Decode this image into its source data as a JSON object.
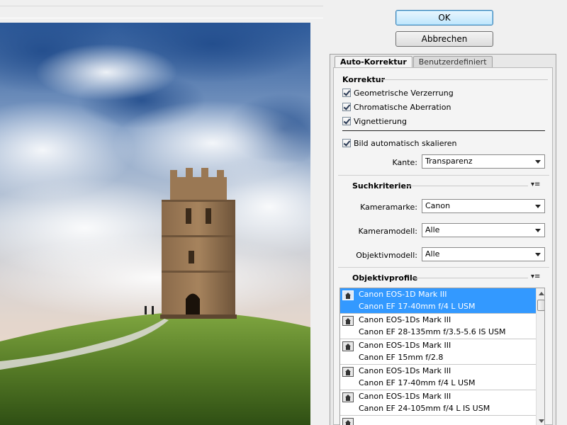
{
  "dialog": {
    "ok_label": "OK",
    "cancel_label": "Abbrechen"
  },
  "tabs": [
    {
      "label": "Auto-Korrektur",
      "active": true
    },
    {
      "label": "Benutzerdefiniert",
      "active": false
    }
  ],
  "korrektur": {
    "title": "Korrektur",
    "options": [
      {
        "label": "Geometrische Verzerrung",
        "checked": true
      },
      {
        "label": "Chromatische Aberration",
        "checked": true
      },
      {
        "label": "Vignettierung",
        "checked": true
      }
    ],
    "auto_scale_label": "Bild automatisch skalieren",
    "auto_scale_checked": true,
    "kante_label": "Kante:",
    "kante_value": "Transparenz"
  },
  "suchkriterien": {
    "title": "Suchkriterien",
    "kameramarke_label": "Kameramarke:",
    "kameramarke_value": "Canon",
    "kameramodell_label": "Kameramodell:",
    "kameramodell_value": "Alle",
    "objektivmodell_label": "Objektivmodell:",
    "objektivmodell_value": "Alle"
  },
  "objektivprofile": {
    "title": "Objektivprofile",
    "items": [
      {
        "camera": "Canon EOS-1D Mark III",
        "lens": "Canon EF 17-40mm f/4 L USM",
        "selected": true
      },
      {
        "camera": "Canon EOS-1Ds Mark III",
        "lens": "Canon EF 28-135mm f/3.5-5.6 IS USM",
        "selected": false
      },
      {
        "camera": "Canon EOS-1Ds Mark III",
        "lens": "Canon EF 15mm f/2.8",
        "selected": false
      },
      {
        "camera": "Canon EOS-1Ds Mark III",
        "lens": "Canon EF 17-40mm f/4 L USM",
        "selected": false
      },
      {
        "camera": "Canon EOS-1Ds Mark III",
        "lens": "Canon EF 24-105mm f/4 L IS USM",
        "selected": false
      }
    ]
  },
  "icons": {
    "panel_menu": "panel-menu-icon",
    "profile": "camera-profile-icon",
    "dropdown": "chevron-down-icon"
  },
  "colors": {
    "selection": "#3399ff",
    "ok_border": "#3c7fb1"
  }
}
